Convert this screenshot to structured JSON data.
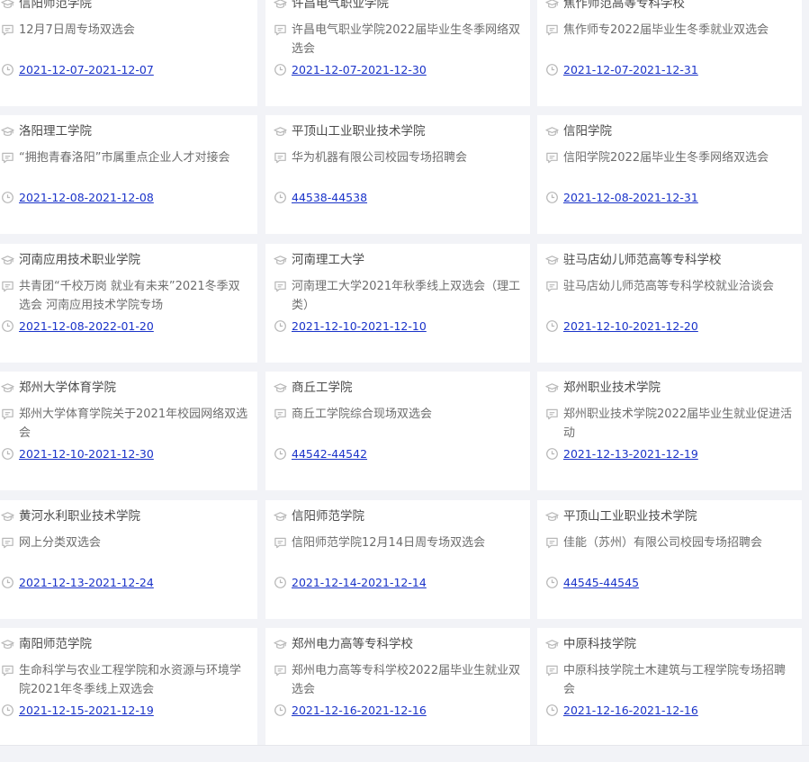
{
  "icons": {
    "title": "graduation-cap-icon",
    "desc": "chat-bubble-icon",
    "date": "clock-icon"
  },
  "colors": {
    "link": "#1a33c9",
    "icon": "#b8b8b8",
    "background": "#f2f3f7"
  },
  "cards": [
    {
      "school": "信阳师范学院",
      "event": "12月7日周专场双选会",
      "date": "2021-12-07-2021-12-07"
    },
    {
      "school": "许昌电气职业学院",
      "event": "许昌电气职业学院2022届毕业生冬季网络双选会",
      "date": "2021-12-07-2021-12-30"
    },
    {
      "school": "焦作师范高等专科学校",
      "event": "焦作师专2022届毕业生冬季就业双选会",
      "date": "2021-12-07-2021-12-31"
    },
    {
      "school": "洛阳理工学院",
      "event": "“拥抱青春洛阳”市属重点企业人才对接会",
      "date": "2021-12-08-2021-12-08"
    },
    {
      "school": "平顶山工业职业技术学院",
      "event": "华为机器有限公司校园专场招聘会",
      "date": "44538-44538"
    },
    {
      "school": "信阳学院",
      "event": "信阳学院2022届毕业生冬季网络双选会",
      "date": "2021-12-08-2021-12-31"
    },
    {
      "school": "河南应用技术职业学院",
      "event": "共青团“千校万岗 就业有未来”2021冬季双选会 河南应用技术学院专场",
      "date": "2021-12-08-2022-01-20"
    },
    {
      "school": "河南理工大学",
      "event": "河南理工大学2021年秋季线上双选会（理工类）",
      "date": "2021-12-10-2021-12-10"
    },
    {
      "school": "驻马店幼儿师范高等专科学校",
      "event": "驻马店幼儿师范高等专科学校就业洽谈会",
      "date": "2021-12-10-2021-12-20"
    },
    {
      "school": "郑州大学体育学院",
      "event": "郑州大学体育学院关于2021年校园网络双选会",
      "date": "2021-12-10-2021-12-30"
    },
    {
      "school": "商丘工学院",
      "event": "商丘工学院综合现场双选会",
      "date": "44542-44542"
    },
    {
      "school": "郑州职业技术学院",
      "event": "郑州职业技术学院2022届毕业生就业促进活动",
      "date": "2021-12-13-2021-12-19"
    },
    {
      "school": "黄河水利职业技术学院",
      "event": "网上分类双选会",
      "date": "2021-12-13-2021-12-24"
    },
    {
      "school": "信阳师范学院",
      "event": "信阳师范学院12月14日周专场双选会",
      "date": "2021-12-14-2021-12-14"
    },
    {
      "school": "平顶山工业职业技术学院",
      "event": "佳能（苏州）有限公司校园专场招聘会",
      "date": "44545-44545"
    },
    {
      "school": "南阳师范学院",
      "event": "生命科学与农业工程学院和水资源与环境学院2021年冬季线上双选会",
      "date": "2021-12-15-2021-12-19"
    },
    {
      "school": "郑州电力高等专科学校",
      "event": "郑州电力高等专科学校2022届毕业生就业双选会",
      "date": "2021-12-16-2021-12-16"
    },
    {
      "school": "中原科技学院",
      "event": "中原科技学院土木建筑与工程学院专场招聘会",
      "date": "2021-12-16-2021-12-16"
    }
  ]
}
